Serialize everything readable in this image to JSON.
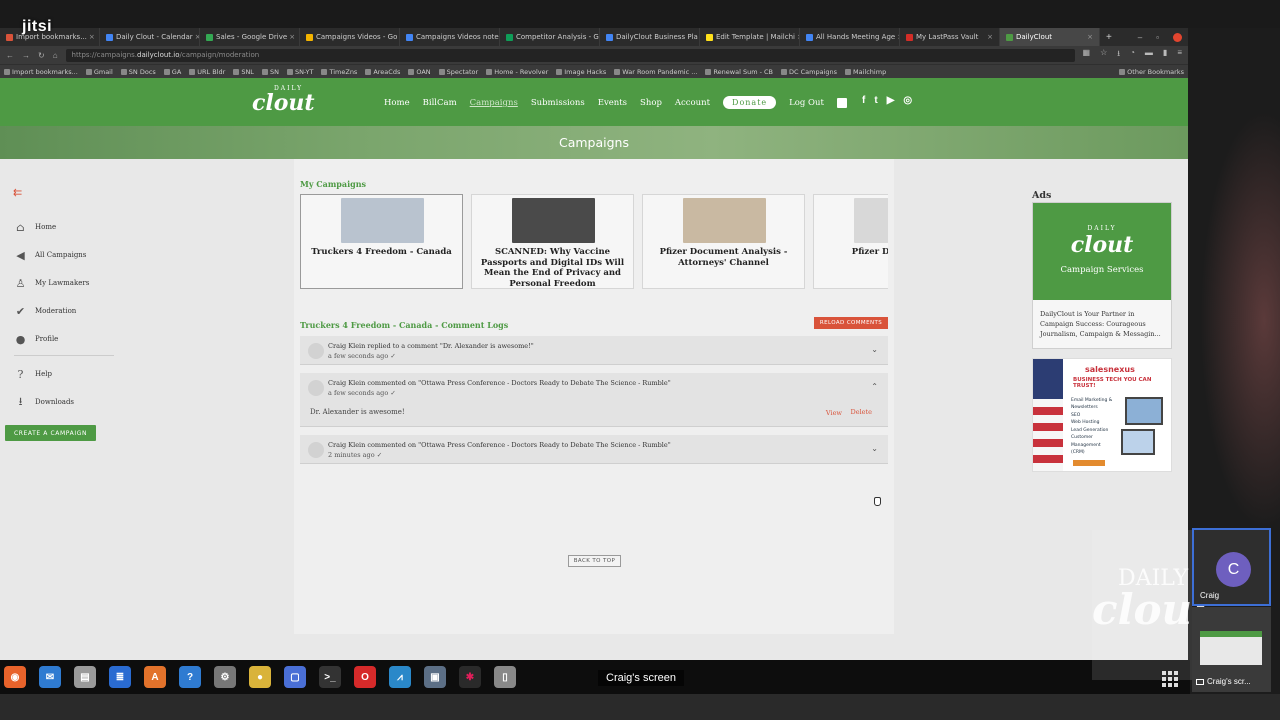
{
  "jitsi_logo": "jitsi",
  "browser": {
    "tabs": [
      {
        "label": "Import bookmarks...",
        "color": "#d9533a"
      },
      {
        "label": "Daily Clout - Calendar",
        "color": "#4285f4"
      },
      {
        "label": "Sales - Google Drive",
        "color": "#34a853"
      },
      {
        "label": "Campaigns Videos - Go",
        "color": "#f4b400"
      },
      {
        "label": "Campaigns Videos note",
        "color": "#4285f4"
      },
      {
        "label": "Competitor Analysis - G",
        "color": "#0f9d58"
      },
      {
        "label": "DailyClout Business Pla",
        "color": "#4285f4"
      },
      {
        "label": "Edit Template | Mailchi",
        "color": "#ffe01b"
      },
      {
        "label": "All Hands Meeting Age",
        "color": "#4285f4"
      },
      {
        "label": "My LastPass Vault",
        "color": "#d32d27"
      },
      {
        "label": "DailyClout",
        "color": "#4e9a44",
        "active": true
      }
    ],
    "new_tab": "+",
    "url_prefix": "https://campaigns.",
    "url_domain": "dailyclout.io",
    "url_path": "/campaign/moderation",
    "bookmarks": [
      "Import bookmarks...",
      "Gmail",
      "SN Docs",
      "GA",
      "URL Bldr",
      "SNL",
      "SN",
      "SN-YT",
      "TimeZns",
      "AreaCds",
      "OAN",
      "Spectator",
      "Home - Revolver",
      "Image Hacks",
      "War Room Pandemic ...",
      "Renewal Sum - CB",
      "DC Campaigns",
      "Mailchimp"
    ],
    "other_bookmarks": "Other Bookmarks"
  },
  "site": {
    "logo_top": "DAILY",
    "logo_main": "clout",
    "nav": [
      "Home",
      "BillCam",
      "Campaigns",
      "Submissions",
      "Events",
      "Shop",
      "Account"
    ],
    "donate": "Donate",
    "logout": "Log Out",
    "socials": [
      "f",
      "t",
      "▶",
      "◎"
    ],
    "banner_title": "Campaigns",
    "sidebar": {
      "back": "⇇",
      "items": [
        {
          "label": "Home",
          "icon": "home-icon",
          "glyph": "⌂"
        },
        {
          "label": "All Campaigns",
          "icon": "megaphone-icon",
          "glyph": "◀"
        },
        {
          "label": "My Lawmakers",
          "icon": "people-icon",
          "glyph": "♙"
        },
        {
          "label": "Moderation",
          "icon": "check-badge-icon",
          "glyph": "✔"
        },
        {
          "label": "Profile",
          "icon": "person-icon",
          "glyph": "●"
        },
        {
          "label": "Help",
          "icon": "help-icon",
          "glyph": "?"
        },
        {
          "label": "Downloads",
          "icon": "download-icon",
          "glyph": "⭳"
        }
      ],
      "create_button": "CREATE A CAMPAIGN"
    },
    "my_campaigns_title": "My Campaigns",
    "campaigns": [
      {
        "title": "Truckers 4 Freedom - Canada",
        "thumb_color": "#b9c3cf"
      },
      {
        "title": "SCANNED: Why Vaccine Passports and Digital IDs Will Mean the End of Privacy and Personal Freedom",
        "thumb_color": "#4a4a4a"
      },
      {
        "title": "Pfizer Document Analysis - Attorneys' Channel",
        "thumb_color": "#c9b9a2"
      },
      {
        "title": "Pfizer Docum War",
        "thumb_color": "#d8d8d8"
      }
    ],
    "log_title": "Truckers 4 Freedom - Canada - Comment Logs",
    "reload_button": "RELOAD COMMENTS",
    "logs": [
      {
        "line1": "Craig Klein replied to a comment \"Dr. Alexander is awesome!\"",
        "line2": "a few seconds ago ✓",
        "expanded": false,
        "chevron": "⌄"
      },
      {
        "line1": "Craig Klein commented on \"Ottawa Press Conference - Doctors Ready to Debate The Science - Rumble\"",
        "line2": "a few seconds ago ✓",
        "expanded": true,
        "chevron": "⌃",
        "body": "Dr. Alexander is awesome!",
        "view": "View",
        "delete": "Delete"
      },
      {
        "line1": "Craig Klein commented on \"Ottawa Press Conference - Doctors Ready to Debate The Science - Rumble\"",
        "line2": "2 minutes ago ✓",
        "expanded": false,
        "chevron": "⌄"
      }
    ],
    "back_to_top": "BACK TO TOP",
    "ads": {
      "title": "Ads",
      "ad1_logo_top": "DAILY",
      "ad1_logo_main": "clout",
      "ad1_sub": "Campaign Services",
      "ad1_text": "DailyClout is Your Partner in Campaign Success: Courageous Journalism, Campaign & Messagin...",
      "ad2_brand": "salesnexus",
      "ad2_tag": "BUSINESS TECH YOU CAN TRUST!",
      "ad2_list": [
        "Email Marketing &",
        "Newsletters",
        "SEO",
        "Web Hosting",
        "Lead Generation",
        "Customer",
        "Management",
        "(CRM)"
      ]
    }
  },
  "meeting": {
    "screen_label": "Craig's screen",
    "participant_initial": "C",
    "participant_name": "Craig",
    "screen_tile_label": "Craig's scr...",
    "watermark_top": "DAILY",
    "watermark_main": "clout"
  },
  "taskbar": [
    {
      "name": "firefox-icon",
      "color": "#e8632b",
      "glyph": "◉"
    },
    {
      "name": "thunderbird-icon",
      "color": "#2f7bd1",
      "glyph": "✉"
    },
    {
      "name": "files-icon",
      "color": "#9a9a9a",
      "glyph": "▤"
    },
    {
      "name": "writer-icon",
      "color": "#2a6bd1",
      "glyph": "≣"
    },
    {
      "name": "software-center-icon",
      "color": "#e2722b",
      "glyph": "A"
    },
    {
      "name": "help-icon",
      "color": "#2f7bd1",
      "glyph": "?"
    },
    {
      "name": "settings-icon",
      "color": "#777777",
      "glyph": "⚙"
    },
    {
      "name": "media-icon",
      "color": "#d9b33a",
      "glyph": "●"
    },
    {
      "name": "screenshot-icon",
      "color": "#4a6fd6",
      "glyph": "▢"
    },
    {
      "name": "terminal-icon",
      "color": "#333333",
      "glyph": ">_"
    },
    {
      "name": "opera-icon",
      "color": "#d62a2a",
      "glyph": "O"
    },
    {
      "name": "chart-app-icon",
      "color": "#2a88c9",
      "glyph": "⩘"
    },
    {
      "name": "image-viewer-icon",
      "color": "#5c6f86",
      "glyph": "▣"
    },
    {
      "name": "slack-icon",
      "color": "#ffffff",
      "glyph": "✱"
    },
    {
      "name": "text-editor-icon",
      "color": "#888888",
      "glyph": "▯"
    }
  ],
  "colors": {
    "brand_green": "#4e9a44",
    "accent_red": "#d9533a"
  }
}
